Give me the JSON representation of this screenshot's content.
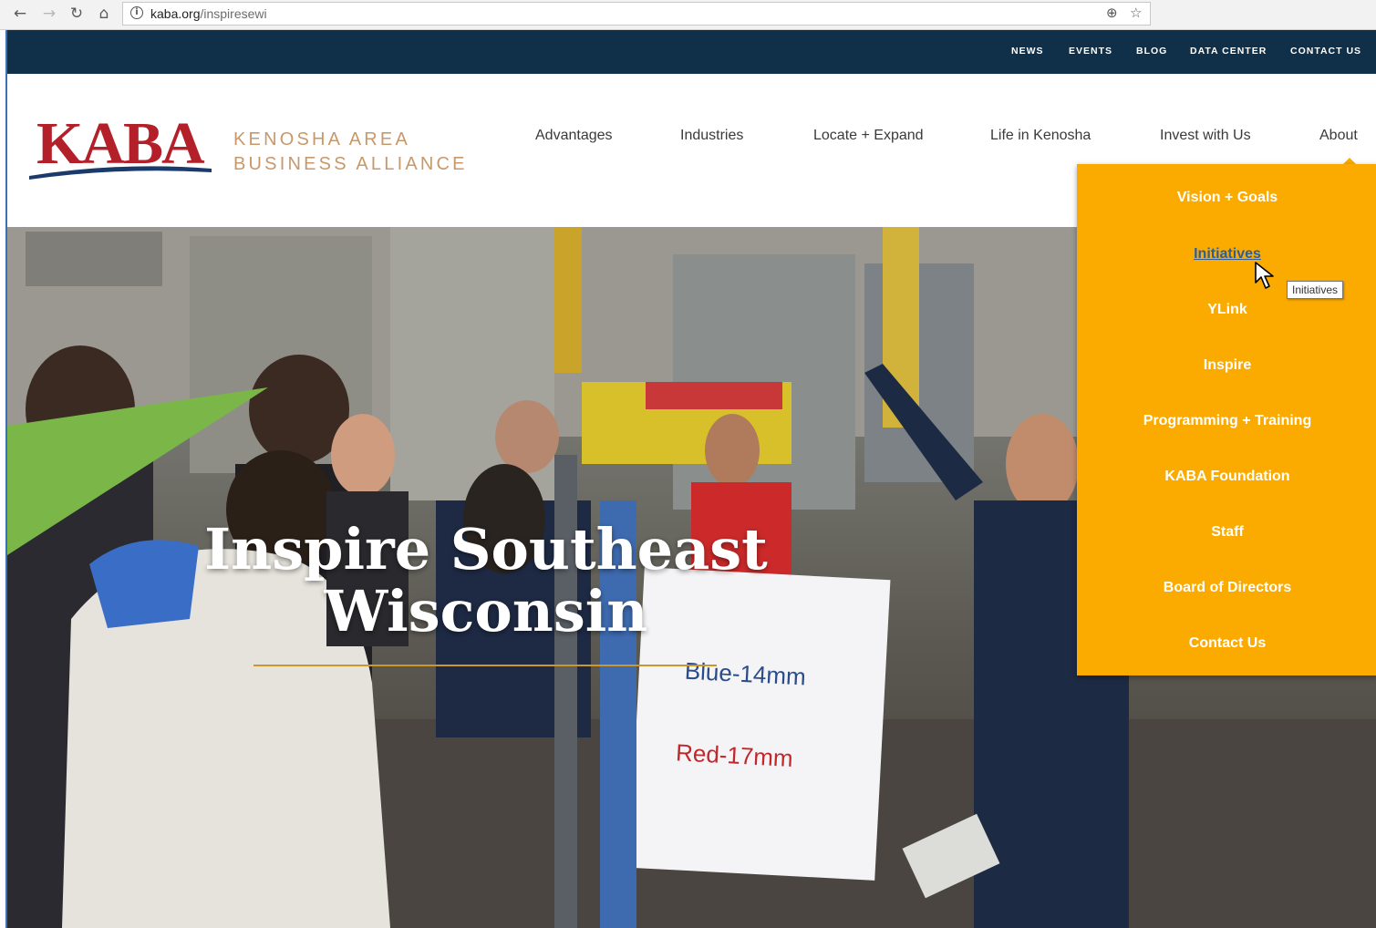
{
  "browser": {
    "url_domain": "kaba.org",
    "url_path": "/inspiresewi",
    "icons": [
      "back-arrow-icon",
      "forward-arrow-icon",
      "reload-icon",
      "home-icon",
      "info-icon",
      "zoom-icon",
      "star-icon"
    ]
  },
  "utility_nav": [
    "NEWS",
    "EVENTS",
    "BLOG",
    "DATA CENTER",
    "CONTACT US"
  ],
  "brand": {
    "mark": "KABA",
    "line1": "KENOSHA AREA",
    "line2": "BUSINESS ALLIANCE",
    "colors": {
      "red": "#b32029",
      "navy": "#1a3a6b",
      "tan": "#c8986a"
    }
  },
  "main_nav": [
    "Advantages",
    "Industries",
    "Locate + Expand",
    "Life in Kenosha",
    "Invest with Us",
    "About"
  ],
  "hero": {
    "title_line1": "Inspire Southeast",
    "title_line2": "Wisconsin",
    "sign_line1": "Blue-14mm",
    "sign_line2": "Red-17mm"
  },
  "dropdown": {
    "items": [
      "Vision + Goals",
      "Initiatives",
      "YLink",
      "Inspire",
      "Programming + Training",
      "KABA Foundation",
      "Staff",
      "Board of Directors",
      "Contact Us"
    ],
    "hovered": "Initiatives",
    "background": "#fbab00"
  },
  "tooltip": "Initiatives",
  "colors": {
    "topbar": "#0f3048",
    "accent_gold": "#c9972c",
    "annotation_arrow": "#7ab648"
  }
}
